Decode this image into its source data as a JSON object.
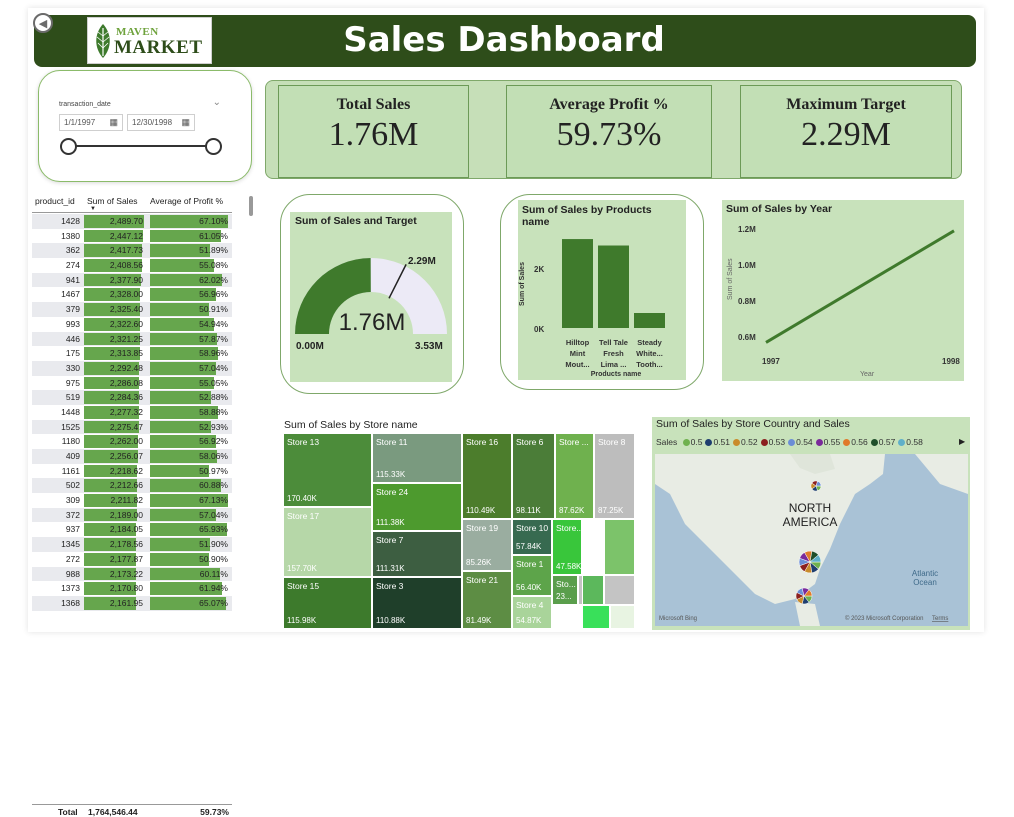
{
  "header": {
    "title": "Sales Dashboard",
    "logo_line1": "MAVEN",
    "logo_line2": "MARKET"
  },
  "slicer": {
    "label": "transaction_date",
    "start_date": "1/1/1997",
    "end_date": "12/30/1998",
    "icons": {
      "calendar": "calendar-icon",
      "dropdown": "chevron-down-icon"
    }
  },
  "kpis": [
    {
      "label": "Total Sales",
      "value": "1.76M"
    },
    {
      "label": "Average Profit %",
      "value": "59.73%"
    },
    {
      "label": "Maximum Target",
      "value": "2.29M"
    }
  ],
  "table": {
    "headers": [
      "product_id",
      "Sum of Sales",
      "Average of Profit %"
    ],
    "rows": [
      {
        "id": "1428",
        "sales": "2,489.70",
        "profit": "67.10%",
        "s": 2489.7,
        "p": 67.1
      },
      {
        "id": "1380",
        "sales": "2,447.12",
        "profit": "61.05%",
        "s": 2447.12,
        "p": 61.05
      },
      {
        "id": "362",
        "sales": "2,417.73",
        "profit": "51.89%",
        "s": 2417.73,
        "p": 51.89
      },
      {
        "id": "274",
        "sales": "2,408.56",
        "profit": "55.08%",
        "s": 2408.56,
        "p": 55.08
      },
      {
        "id": "941",
        "sales": "2,377.90",
        "profit": "62.02%",
        "s": 2377.9,
        "p": 62.02
      },
      {
        "id": "1467",
        "sales": "2,328.00",
        "profit": "56.96%",
        "s": 2328.0,
        "p": 56.96
      },
      {
        "id": "379",
        "sales": "2,325.40",
        "profit": "50.91%",
        "s": 2325.4,
        "p": 50.91
      },
      {
        "id": "993",
        "sales": "2,322.60",
        "profit": "54.94%",
        "s": 2322.6,
        "p": 54.94
      },
      {
        "id": "446",
        "sales": "2,321.25",
        "profit": "57.87%",
        "s": 2321.25,
        "p": 57.87
      },
      {
        "id": "175",
        "sales": "2,313.85",
        "profit": "58.96%",
        "s": 2313.85,
        "p": 58.96
      },
      {
        "id": "330",
        "sales": "2,292.48",
        "profit": "57.04%",
        "s": 2292.48,
        "p": 57.04
      },
      {
        "id": "975",
        "sales": "2,286.08",
        "profit": "55.05%",
        "s": 2286.08,
        "p": 55.05
      },
      {
        "id": "519",
        "sales": "2,284.36",
        "profit": "52.88%",
        "s": 2284.36,
        "p": 52.88
      },
      {
        "id": "1448",
        "sales": "2,277.32",
        "profit": "58.88%",
        "s": 2277.32,
        "p": 58.88
      },
      {
        "id": "1525",
        "sales": "2,275.47",
        "profit": "52.93%",
        "s": 2275.47,
        "p": 52.93
      },
      {
        "id": "1180",
        "sales": "2,262.00",
        "profit": "56.92%",
        "s": 2262.0,
        "p": 56.92
      },
      {
        "id": "409",
        "sales": "2,256.07",
        "profit": "58.06%",
        "s": 2256.07,
        "p": 58.06
      },
      {
        "id": "1161",
        "sales": "2,218.62",
        "profit": "50.97%",
        "s": 2218.62,
        "p": 50.97
      },
      {
        "id": "502",
        "sales": "2,212.66",
        "profit": "60.88%",
        "s": 2212.66,
        "p": 60.88
      },
      {
        "id": "309",
        "sales": "2,211.82",
        "profit": "67.13%",
        "s": 2211.82,
        "p": 67.13
      },
      {
        "id": "372",
        "sales": "2,189.00",
        "profit": "57.04%",
        "s": 2189.0,
        "p": 57.04
      },
      {
        "id": "937",
        "sales": "2,184.05",
        "profit": "65.93%",
        "s": 2184.05,
        "p": 65.93
      },
      {
        "id": "1345",
        "sales": "2,178.56",
        "profit": "51.90%",
        "s": 2178.56,
        "p": 51.9
      },
      {
        "id": "272",
        "sales": "2,177.87",
        "profit": "50.90%",
        "s": 2177.87,
        "p": 50.9
      },
      {
        "id": "988",
        "sales": "2,173.22",
        "profit": "60.11%",
        "s": 2173.22,
        "p": 60.11
      },
      {
        "id": "1373",
        "sales": "2,170.80",
        "profit": "61.94%",
        "s": 2170.8,
        "p": 61.94
      },
      {
        "id": "1368",
        "sales": "2,161.95",
        "profit": "65.07%",
        "s": 2161.95,
        "p": 65.07
      }
    ],
    "total": {
      "label": "Total",
      "sales": "1,764,546.44",
      "profit": "59.73%"
    }
  },
  "gauge": {
    "title": "Sum of Sales and Target",
    "value_label": "1.76M",
    "min_label": "0.00M",
    "max_label": "3.53M",
    "target_label": "2.29M",
    "value": 1.76,
    "min": 0,
    "max": 3.53,
    "target": 2.29
  },
  "products_chart": {
    "title": "Sum of Sales by Products name",
    "xlabel": "Products name",
    "ylabel": "Sum of Sales",
    "ticks": [
      "2K",
      "0K"
    ],
    "categories": [
      "Hilltop Mint Mout...",
      "Tell Tale Fresh Lima ...",
      "Steady White... Tooth..."
    ],
    "cat_lines": [
      [
        "Hilltop",
        "Mint",
        "Mout..."
      ],
      [
        "Tell Tale",
        "Fresh",
        "Lima ..."
      ],
      [
        "Steady",
        "White...",
        "Tooth..."
      ]
    ],
    "values": [
      2.49,
      2.31,
      0.42
    ],
    "ylim": [
      0,
      2.8
    ]
  },
  "year_chart": {
    "title": "Sum of Sales by Year",
    "xlabel": "Year",
    "ylabel": "Sum of Sales",
    "yticks": [
      "1.2M",
      "1.0M",
      "0.8M",
      "0.6M"
    ],
    "ytick_values": [
      1.2,
      1.0,
      0.8,
      0.6
    ],
    "xticks": [
      "1997",
      "1998"
    ],
    "x": [
      1997,
      1998
    ],
    "y": [
      0.57,
      1.19
    ],
    "ylim": [
      0.55,
      1.25
    ]
  },
  "treemap": {
    "title": "Sum of Sales by Store name",
    "stores": [
      {
        "name": "Store 13",
        "value": "170.40K",
        "color": "#4c8c3a"
      },
      {
        "name": "Store 17",
        "value": "157.70K",
        "color": "#b6d7a8"
      },
      {
        "name": "Store 15",
        "value": "115.98K",
        "color": "#3d7a2c"
      },
      {
        "name": "Store 11",
        "value": "115.33K",
        "color": "#7a9a7f"
      },
      {
        "name": "Store 24",
        "value": "111.38K",
        "color": "#4d9a2e"
      },
      {
        "name": "Store 7",
        "value": "111.31K",
        "color": "#3d5e41"
      },
      {
        "name": "Store 3",
        "value": "110.88K",
        "color": "#1f3f2a"
      },
      {
        "name": "Store 16",
        "value": "110.49K",
        "color": "#4c7d2c"
      },
      {
        "name": "Store 19",
        "value": "85.26K",
        "color": "#9aada0"
      },
      {
        "name": "Store 21",
        "value": "81.49K",
        "color": "#5d8d44"
      },
      {
        "name": "Store 6",
        "value": "98.11K",
        "color": "#4b7d38"
      },
      {
        "name": "Store 10",
        "value": "57.84K",
        "color": "#376a50"
      },
      {
        "name": "Store 1",
        "value": "56.40K",
        "color": "#5da44a"
      },
      {
        "name": "Store 4",
        "value": "54.87K",
        "color": "#a9d49a"
      },
      {
        "name": "Store ...",
        "value": "87.62K",
        "color": "#6fb14e"
      },
      {
        "name": "Store 8",
        "value": "87.25K",
        "color": "#bdbdbd"
      },
      {
        "name": "Store...",
        "value": "47.58K",
        "color": "#39c63b"
      },
      {
        "name": "Sto...",
        "value": "23...",
        "color": "#5a9e4c"
      },
      {
        "name": "St...",
        "value": "22...",
        "color": "#c4c4c4"
      }
    ]
  },
  "map_card": {
    "title": "Sum of Sales by Store Country and Sales",
    "legend_label": "Sales",
    "legend": [
      {
        "label": "0.5",
        "color": "#6fb14e"
      },
      {
        "label": "0.51",
        "color": "#1f3f6f"
      },
      {
        "label": "0.52",
        "color": "#c98b2b"
      },
      {
        "label": "0.53",
        "color": "#8b1f1f"
      },
      {
        "label": "0.54",
        "color": "#6b8ed6"
      },
      {
        "label": "0.55",
        "color": "#7a2a9a"
      },
      {
        "label": "0.56",
        "color": "#e07a2a"
      },
      {
        "label": "0.57",
        "color": "#1f4f2a"
      },
      {
        "label": "0.58",
        "color": "#5fb0c9"
      }
    ],
    "continent_label": [
      "NORTH",
      "AMERICA"
    ],
    "ocean_label": [
      "Atlantic",
      "Ocean"
    ],
    "attribution": "© 2023 Microsoft Corporation",
    "attribution_link": "Terms",
    "bing_label": "Microsoft Bing"
  }
}
